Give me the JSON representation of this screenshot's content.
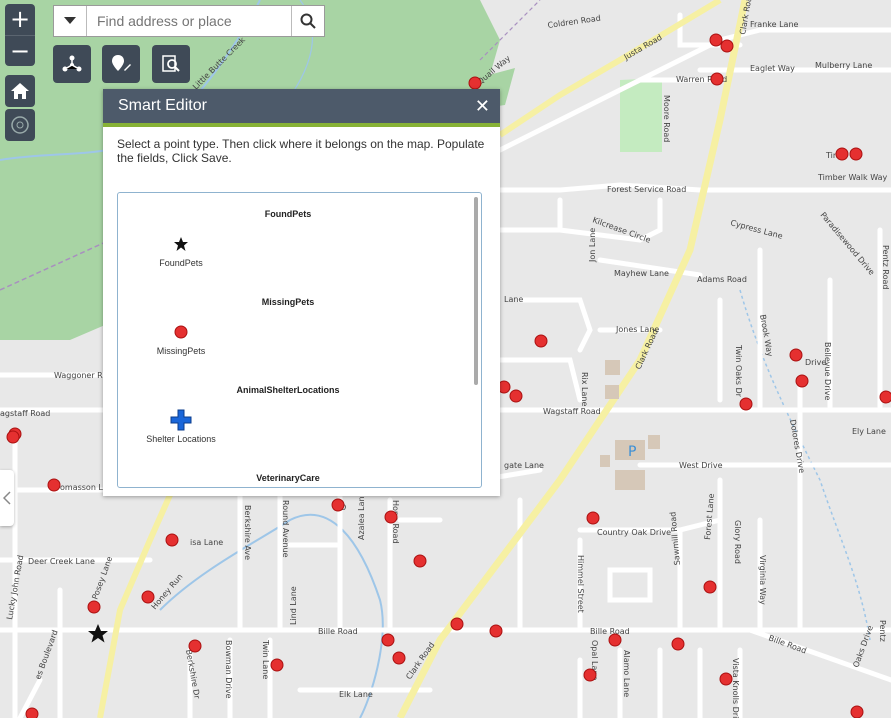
{
  "search": {
    "placeholder": "Find address or place"
  },
  "zoom": {
    "in_label": "+",
    "out_label": "−"
  },
  "editor": {
    "title": "Smart Editor",
    "close_label": "✕",
    "instructions": "Select a point type. Then click where it belongs on the map. Populate the fields, Click Save.",
    "groups": [
      {
        "title": "FoundPets",
        "item_label": "FoundPets",
        "symbol": "star-icon"
      },
      {
        "title": "MissingPets",
        "item_label": "MissingPets",
        "symbol": "red-dot-icon"
      },
      {
        "title": "AnimalShelterLocations",
        "item_label": "Shelter Locations",
        "symbol": "blue-cross-icon"
      },
      {
        "title": "VeterinaryCare"
      }
    ]
  },
  "map": {
    "parking_label": "P",
    "roads": {
      "coldren": "Coldren Road",
      "franke": "Franke Lane",
      "justa": "Justa Road",
      "eaglet": "Eaglet Way",
      "mulberry": "Mulberry Lane",
      "warren": "Warren Road",
      "moore": "Moore Road",
      "clark": "Clark Road",
      "quail": "Quail Way",
      "butte_creek": "Little Butte Creek",
      "tim": "Tim",
      "timber_walk": "Timber Walk Way",
      "forest_service": "Forest Service Road",
      "kilcrease": "Kilcrease Circle",
      "cypress": "Cypress Lane",
      "paradisewood": "Paradisewood Drive",
      "pentz": "Pentz Road",
      "jon": "Jon Lane",
      "mayhew": "Mayhew Lane",
      "adams": "Adams Road",
      "jones": "Jones Lane",
      "brook": "Brook Way",
      "twin_oaks": "Twin Oaks Dr",
      "rix": "Rix Lane",
      "bellevue": "Bellevue Drive",
      "drive": "Drive",
      "waggoner": "Waggoner R",
      "wagstaff": "Wagstaff Road",
      "wagstaff_left": "agstaff Road",
      "dolores": "Dolores Drive",
      "ely": "Ely Lane",
      "west": "West Drive",
      "gate": "gate Lane",
      "lane": "Lane",
      "country_oak": "Country Oak Drive",
      "forest_lane": "Forest Lane",
      "glory": "Glory Road",
      "virginia": "Virginia Way",
      "masson": "omasson L",
      "deer_creek": "Deer Creek Lane",
      "lucky_john": "Lucky John Road",
      "posey": "Posey Lane",
      "honey_run": "Honey Run",
      "berkshire_ave": "Berkshire Ave",
      "round": "Round Avenue",
      "azalea": "Azalea Lane",
      "hope": "Hope Road",
      "o": "O",
      "himmel": "Himmel Street",
      "sawmill": "Sawmill Road",
      "bille": "Bille Road",
      "berkshire_dr": "Berkshire Dr",
      "bowman": "Bowman Drive",
      "twin_lane": "Twin Lane",
      "lind": "Lind Lane",
      "opal": "Opal Lane",
      "alamo": "Alamo Lane",
      "vista_knolls": "Vista Knolls Drive",
      "oaks": "Oaks Drive",
      "elk": "Elk Lane",
      "boulevard": "es Boulevard",
      "isa": "isa Lane",
      "oak_nd": "O",
      "penr": "Pentz"
    }
  },
  "colors": {
    "panel_header": "#4d5a6a",
    "accent": "#87b236",
    "marker": "#e53030",
    "shelter": "#1a66d9",
    "park": "#a8d4a4"
  }
}
